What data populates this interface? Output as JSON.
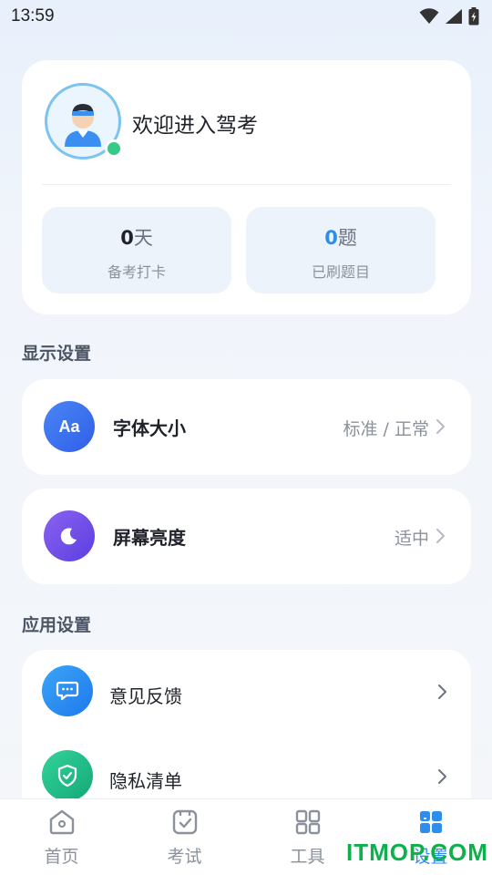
{
  "status_bar": {
    "time": "13:59"
  },
  "profile": {
    "welcome_text": "欢迎进入驾考",
    "stats": [
      {
        "value": "0",
        "unit": "天",
        "label": "备考打卡"
      },
      {
        "value": "0",
        "unit": "题",
        "label": "已刷题目"
      }
    ]
  },
  "display_settings": {
    "title": "显示设置",
    "items": [
      {
        "label": "字体大小",
        "value": "标准 / 正常",
        "icon": "font-size-icon",
        "icon_text": "Aa",
        "color": "#3a6ff0"
      },
      {
        "label": "屏幕亮度",
        "value": "适中",
        "icon": "moon-icon",
        "color": "#7150e8"
      }
    ]
  },
  "app_settings": {
    "title": "应用设置",
    "items": [
      {
        "label": "意见反馈",
        "icon": "feedback-icon",
        "color": "#2b8ff2"
      },
      {
        "label": "隐私清单",
        "icon": "privacy-shield-icon",
        "color": "#22c08a"
      }
    ]
  },
  "bottom_nav": {
    "items": [
      {
        "label": "首页",
        "icon": "home-icon"
      },
      {
        "label": "考试",
        "icon": "exam-icon"
      },
      {
        "label": "工具",
        "icon": "tools-icon"
      },
      {
        "label": "设置",
        "icon": "settings-grid-icon",
        "active": true
      }
    ]
  },
  "watermark": "ITMOP.COM",
  "colors": {
    "accent": "#2e8ef0",
    "online": "#36c987"
  }
}
